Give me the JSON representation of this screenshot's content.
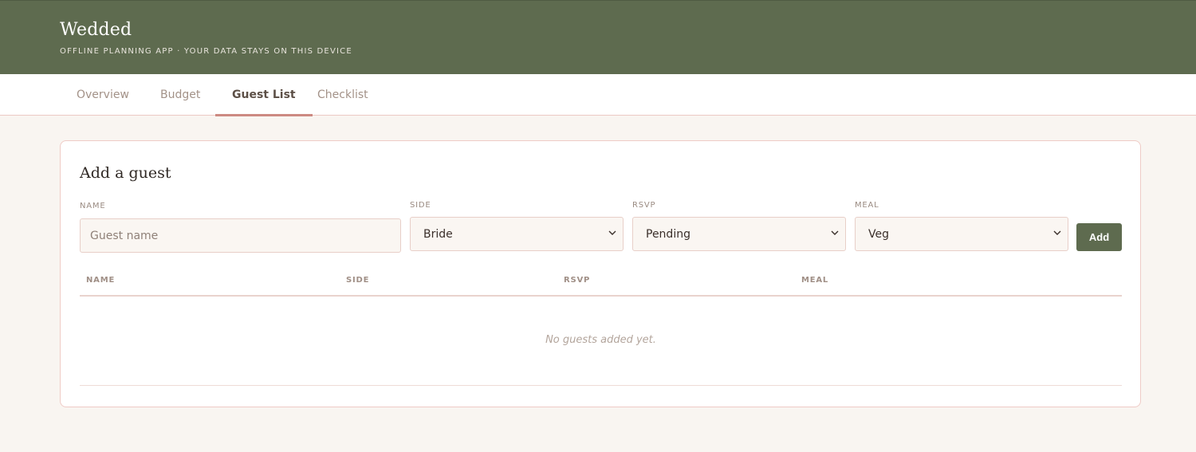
{
  "header": {
    "brand": "Wedded",
    "tagline": "OFFLINE PLANNING APP · YOUR DATA STAYS ON THIS DEVICE"
  },
  "tabs": [
    {
      "label": "Overview",
      "active": false
    },
    {
      "label": "Budget",
      "active": false
    },
    {
      "label": "Guest List",
      "active": true
    },
    {
      "label": "Checklist",
      "active": false
    }
  ],
  "form": {
    "title": "Add a guest",
    "name_label": "NAME",
    "name_placeholder": "Guest name",
    "name_value": "",
    "side_label": "SIDE",
    "side_value": "Bride",
    "rsvp_label": "RSVP",
    "rsvp_value": "Pending",
    "meal_label": "MEAL",
    "meal_value": "Veg",
    "add_label": "Add"
  },
  "table": {
    "columns": [
      "NAME",
      "SIDE",
      "RSVP",
      "MEAL"
    ],
    "rows": [],
    "empty_message": "No guests added yet."
  },
  "colors": {
    "header_bg": "#5e6b4f",
    "accent": "#cd8a82",
    "page_bg": "#f9f5f1",
    "button_bg": "#5e6b4f"
  },
  "icons": {
    "select_chevron": "chevron-down-icon"
  }
}
